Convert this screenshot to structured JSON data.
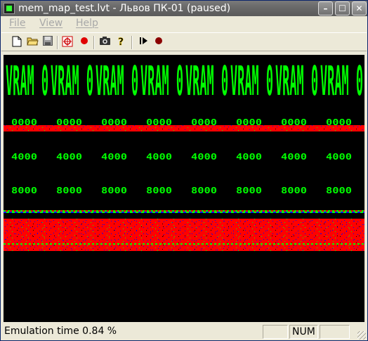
{
  "window": {
    "title": "mem_map_test.lvt - Львов ПК-01 (paused)"
  },
  "titlebar_buttons": {
    "minimize": "–",
    "maximize": "☐",
    "close": "✕"
  },
  "menu": [
    "File",
    "View",
    "Help"
  ],
  "toolbar_icons": [
    "new-file-icon",
    "open-folder-icon",
    "save-icon",
    "target-icon",
    "record-icon",
    "camera-icon",
    "help-icon",
    "play-step-icon",
    "stop-record-icon"
  ],
  "screen": {
    "vram_label": "VRAM 0",
    "addr_rows": [
      "0000",
      "4000",
      "8000"
    ],
    "colors": {
      "green": "#00ff00",
      "red": "#ff0000",
      "blue": "#0000ff",
      "black": "#000000"
    }
  },
  "status": {
    "emulation_time": "Emulation time  0.84 %",
    "num": "NUM"
  }
}
